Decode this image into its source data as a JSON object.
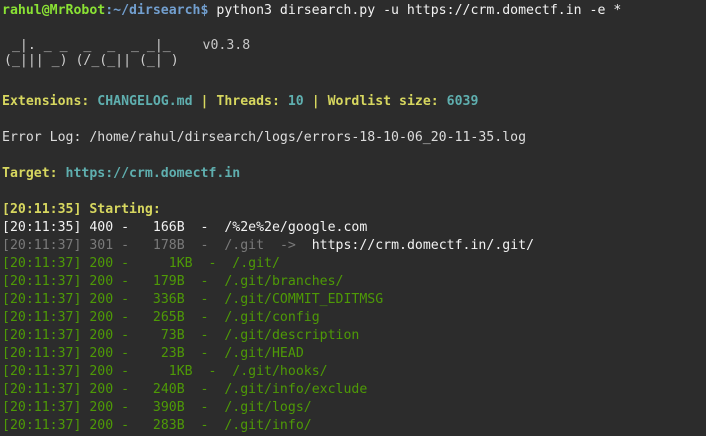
{
  "prompt": {
    "user_host": "rahul@MrRobot",
    "path": ":~/dirsearch$",
    "command": " python3 dirsearch.py -u https://crm.domectf.in -e *"
  },
  "logo": {
    "line1": " _|. _ _  _  _  _ _|_    ",
    "line2": "(_||| _) (/_(_|| (_| )   ",
    "version": "v0.3.8"
  },
  "config": {
    "ext_label": "Extensions: ",
    "ext_value": "CHANGELOG.md",
    "sep1": " | ",
    "threads_label": "Threads: ",
    "threads_value": "10",
    "sep2": " | ",
    "wordlist_label": "Wordlist size: ",
    "wordlist_value": "6039"
  },
  "error_log": "Error Log: /home/rahul/dirsearch/logs/errors-18-10-06_20-11-35.log",
  "target": {
    "label": "Target: ",
    "value": "https://crm.domectf.in"
  },
  "starting": "[20:11:35] Starting:",
  "results": [
    {
      "time": "[20:11:35]",
      "status": "400",
      "size": " 166B",
      "path": "/%2e%2e/google.com",
      "redirect": "",
      "style": "white"
    },
    {
      "time": "[20:11:37]",
      "status": "301",
      "size": " 178B",
      "path": "/.git",
      "redirect": "https://crm.domectf.in/.git/",
      "style": "grey"
    },
    {
      "time": "[20:11:37]",
      "status": "200",
      "size": "   1KB",
      "path": "/.git/",
      "redirect": "",
      "style": "green"
    },
    {
      "time": "[20:11:37]",
      "status": "200",
      "size": " 179B",
      "path": "/.git/branches/",
      "redirect": "",
      "style": "green"
    },
    {
      "time": "[20:11:37]",
      "status": "200",
      "size": " 336B",
      "path": "/.git/COMMIT_EDITMSG",
      "redirect": "",
      "style": "green"
    },
    {
      "time": "[20:11:37]",
      "status": "200",
      "size": " 265B",
      "path": "/.git/config",
      "redirect": "",
      "style": "green"
    },
    {
      "time": "[20:11:37]",
      "status": "200",
      "size": "  73B",
      "path": "/.git/description",
      "redirect": "",
      "style": "green"
    },
    {
      "time": "[20:11:37]",
      "status": "200",
      "size": "  23B",
      "path": "/.git/HEAD",
      "redirect": "",
      "style": "green"
    },
    {
      "time": "[20:11:37]",
      "status": "200",
      "size": "   1KB",
      "path": "/.git/hooks/",
      "redirect": "",
      "style": "green"
    },
    {
      "time": "[20:11:37]",
      "status": "200",
      "size": " 240B",
      "path": "/.git/info/exclude",
      "redirect": "",
      "style": "green"
    },
    {
      "time": "[20:11:37]",
      "status": "200",
      "size": " 390B",
      "path": "/.git/logs/",
      "redirect": "",
      "style": "green"
    },
    {
      "time": "[20:11:37]",
      "status": "200",
      "size": " 283B",
      "path": "/.git/info/",
      "redirect": "",
      "style": "green"
    }
  ]
}
